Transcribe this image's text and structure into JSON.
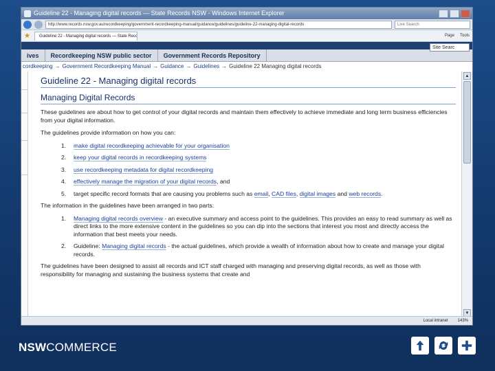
{
  "browser": {
    "title": "Guideline 22 - Managing digital records — State Records NSW - Windows Internet Explorer",
    "address": "http://www.records.nsw.gov.au/recordkeeping/government-recordkeeping-manual/guidance/guidelines/guideline-22-managing-digital-records",
    "search_placeholder": "Live Search",
    "tab_label": "Guideline 22 - Managing digital records — State Reco...",
    "cmd_page": "Page",
    "cmd_tools": "Tools",
    "status_left": "",
    "status_zone": "Local intranet",
    "status_zoom": "143%"
  },
  "site": {
    "search_label": "Site Searc",
    "nav": [
      "ives",
      "Recordkeeping NSW public sector",
      "Government Records Repository"
    ]
  },
  "breadcrumb": {
    "items": [
      "cordkeeping",
      "Government Recordkeeping Manual",
      "Guidance",
      "Guidelines"
    ],
    "separator": "→",
    "current": "Guideline 22 Managing digital records"
  },
  "page": {
    "title": "Guideline 22 - Managing digital records",
    "subtitle": "Managing Digital Records",
    "intro": "These guidelines are about how to get control of your digital records and maintain them effectively to achieve immediate and long term business efficiencies from your digital information.",
    "provide_lead": "The guidelines provide information on how you can:",
    "list1": [
      {
        "num": "1.",
        "link": "make digital recordkeeping achievable for your organisation",
        "rest": ""
      },
      {
        "num": "2.",
        "link": "keep your digital records in recordkeeping systems",
        "rest": ""
      },
      {
        "num": "3.",
        "link": "use recordkeeping metadata for digital recordkeeping",
        "rest": ""
      },
      {
        "num": "4.",
        "link": "effectively manage the migration of your digital records",
        "rest": ", and"
      }
    ],
    "item5": {
      "num": "5.",
      "pre": "target specific record formats that are causing you problems such as ",
      "link1": "email",
      "sep1": ", ",
      "link2": "CAD files",
      "sep2": ", ",
      "link3": "digital images",
      "sep3": " and ",
      "link4": "web records",
      "end": "."
    },
    "arranged_lead": "The information in the guidelines have been arranged in two parts:",
    "part1": {
      "num": "1.",
      "link": "Managing digital records overview",
      "text": " - an executive summary and access point to the guidelines. This provides an easy to read summary as well as direct links to the more extensive content in the guidelines so you can dip into the sections that interest you most and directly access the information that best meets your needs."
    },
    "part2": {
      "num": "2.",
      "pre": "Guideline: ",
      "link": "Managing digital records",
      "text": " - the actual guidelines, which provide a wealth of information about how to create and manage your digital records."
    },
    "closing": "The guidelines have been designed to assist all records and ICT staff charged with managing and preserving digital records, as well as those with responsibility for managing and sustaining the business systems that create and"
  },
  "footer": {
    "brand_bold": "NSW",
    "brand_rest": "COMMERCE",
    "icons": [
      "up-arrow-icon",
      "back-cycle-icon",
      "plus-icon"
    ]
  }
}
